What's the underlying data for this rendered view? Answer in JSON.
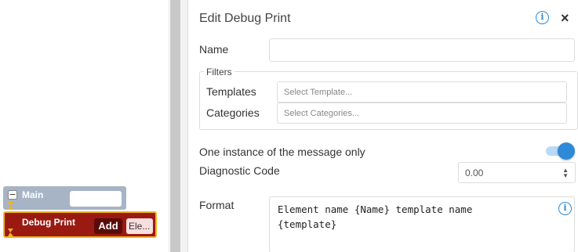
{
  "canvas": {
    "main_block": {
      "label": "Main",
      "collapse_symbol": "−",
      "field_value": ""
    },
    "debug_block": {
      "label": "Debug Print",
      "add_label": "Add",
      "element_label": "Ele..."
    }
  },
  "panel": {
    "title": "Edit Debug Print",
    "info_icon": "i",
    "close_icon": "×",
    "name": {
      "label": "Name",
      "value": ""
    },
    "filters": {
      "legend": "Filters",
      "templates": {
        "label": "Templates",
        "placeholder": "Select Template..."
      },
      "categories": {
        "label": "Categories",
        "placeholder": "Select Categories..."
      }
    },
    "one_instance": {
      "label": "One instance of the message only",
      "enabled": true
    },
    "diagnostic_code": {
      "label": "Diagnostic Code",
      "value": "0.00"
    },
    "format": {
      "label": "Format",
      "value": "Element name {Name} template name\n{template}"
    }
  },
  "colors": {
    "accent": "#2e8ad8",
    "debug_block": "#9a1a12",
    "debug_border": "#f2b51c",
    "main_block": "#a6b4c5"
  }
}
